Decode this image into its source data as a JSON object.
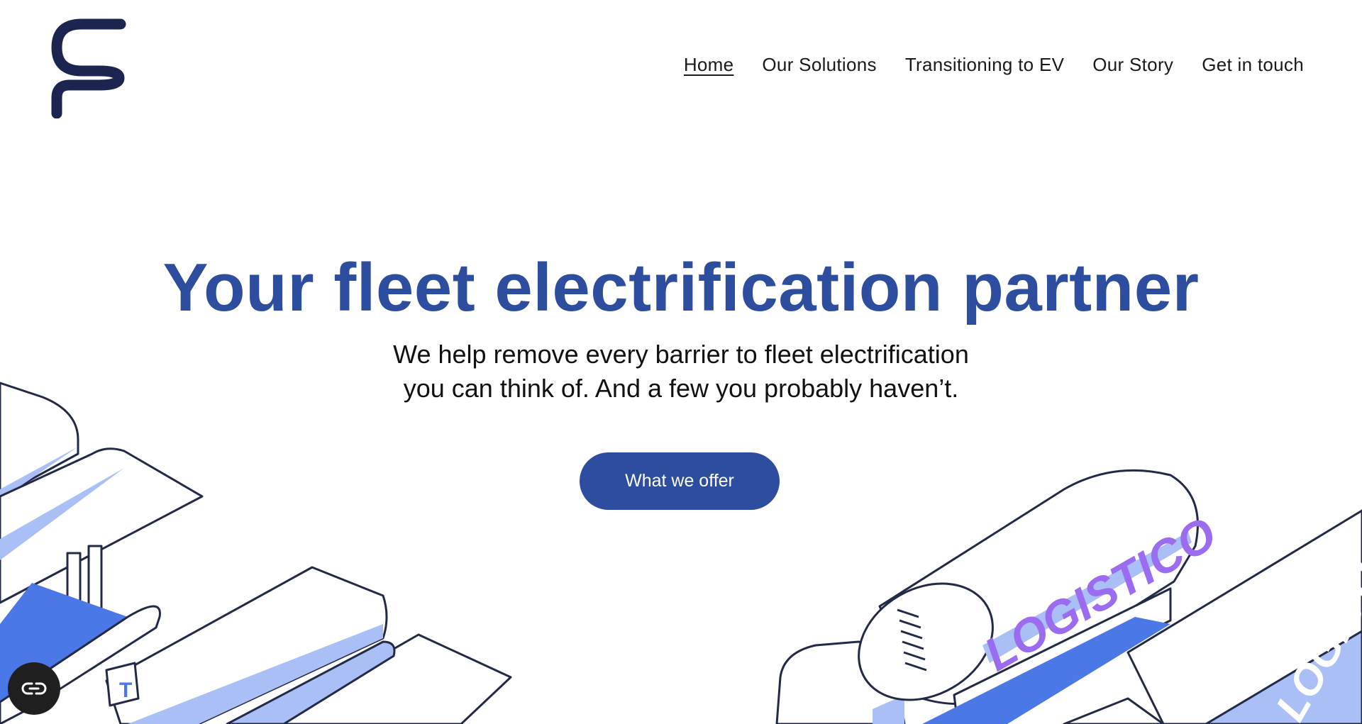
{
  "brand": {
    "logo_icon": "fleet-logo-icon",
    "color": "#1c2550"
  },
  "nav": {
    "items": [
      {
        "label": "Home",
        "active": true
      },
      {
        "label": "Our Solutions",
        "active": false
      },
      {
        "label": "Transitioning to EV",
        "active": false
      },
      {
        "label": "Our Story",
        "active": false
      },
      {
        "label": "Get in touch",
        "active": false
      }
    ]
  },
  "hero": {
    "title": "Your fleet electrification partner",
    "subtitle_line1": "We help remove every barrier to fleet electrification",
    "subtitle_line2": "you can think of. And a few you probably haven’t.",
    "cta_label": "What we offer"
  },
  "illustration": {
    "truck_text_1": "LOGISTICO",
    "truck_text_2": "LOGISTIC",
    "sign_letter": "T"
  },
  "accessibility": {
    "icon": "accessibility-link-icon"
  },
  "colors": {
    "accent": "#2d4d9e",
    "light_blue": "#a9bff5",
    "bright_blue": "#4a78e6",
    "purple": "#9b6cf0",
    "outline": "#232a45"
  }
}
